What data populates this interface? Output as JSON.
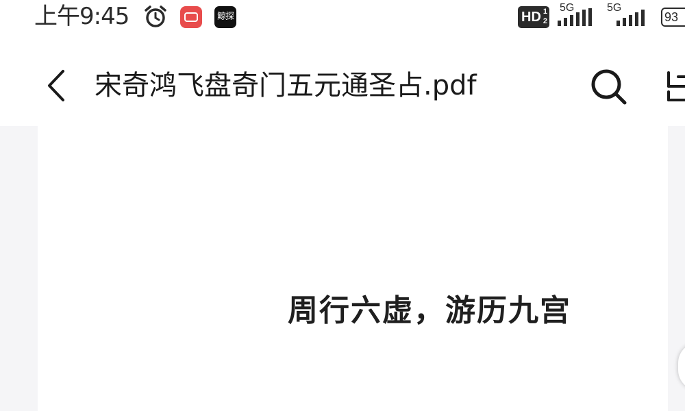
{
  "status_bar": {
    "time": "上午9:45",
    "app_icon_black_label": "鲸探",
    "hd_label": "HD",
    "hd_sub_top": "1",
    "hd_sub_bottom": "2",
    "network_1": "5G",
    "network_2": "5G",
    "battery": "93",
    "icons": [
      "alarm-icon",
      "app-icon-red",
      "app-icon-black",
      "hd-badge",
      "signal-icon",
      "signal-icon",
      "battery-icon"
    ]
  },
  "title_bar": {
    "title": "宋奇鸿飞盘奇门五元通圣占.pdf",
    "icons": [
      "back-icon",
      "search-icon",
      "more-icon"
    ]
  },
  "document": {
    "heading": "周行六虚，游历九宫"
  },
  "colors": {
    "app_red": "#e84c4c",
    "background": "#ffffff",
    "doc_background": "#f5f5f7",
    "text": "#1a1a1a"
  }
}
